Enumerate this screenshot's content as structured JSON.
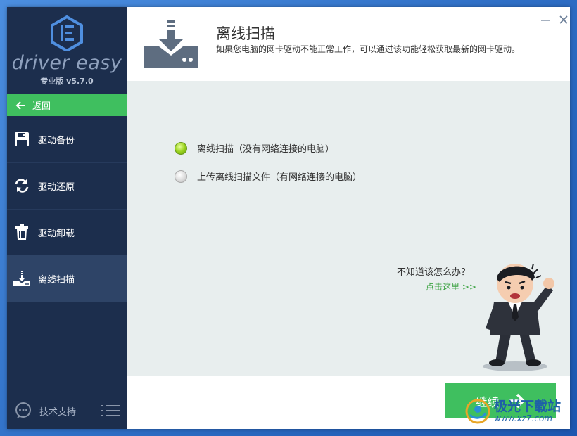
{
  "sidebar": {
    "brand": "driver easy",
    "version": "专业版 v5.7.0",
    "back_label": "返回",
    "items": [
      {
        "label": "驱动备份",
        "icon": "save-icon"
      },
      {
        "label": "驱动还原",
        "icon": "refresh-icon"
      },
      {
        "label": "驱动卸载",
        "icon": "trash-icon"
      },
      {
        "label": "离线扫描",
        "icon": "download-icon"
      }
    ],
    "support_label": "技术支持"
  },
  "header": {
    "title": "离线扫描",
    "description": "如果您电脑的网卡驱动不能正常工作，可以通过该功能轻松获取最新的网卡驱动。"
  },
  "options": [
    {
      "label": "离线扫描（没有网络连接的电脑）",
      "selected": true
    },
    {
      "label": "上传离线扫描文件（有网络连接的电脑）",
      "selected": false
    }
  ],
  "help": {
    "question": "不知道该怎么办？",
    "link": "点击这里 >>"
  },
  "footer": {
    "continue_label": "继续"
  },
  "watermark": {
    "top": "极光下载站",
    "bottom": "www.xz7.com"
  },
  "colors": {
    "sidebar": "#1c2e4d",
    "accent_green": "#3fbf5f",
    "content_bg": "#e8eeee"
  }
}
